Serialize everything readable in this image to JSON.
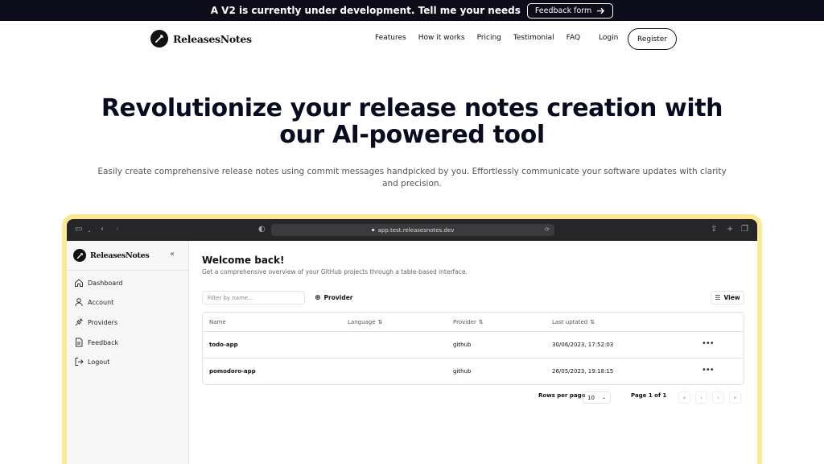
{
  "announcement": {
    "text": "A V2 is currently under development. Tell me your needs",
    "button_label": "Feedback form"
  },
  "brand": {
    "name": "ReleasesNotes"
  },
  "nav": {
    "links": [
      "Features",
      "How it works",
      "Pricing",
      "Testimonial",
      "FAQ"
    ],
    "login": "Login",
    "register": "Register"
  },
  "hero": {
    "title_line1": "Revolutionize your release notes creation with",
    "title_line2": "our AI-powered tool",
    "subtitle": "Easily create comprehensive release notes using commit messages handpicked by you. Effortlessly communicate your software updates with clarity and precision."
  },
  "browser": {
    "url": "app.test.releasesnotes.dev"
  },
  "app": {
    "sidebar": {
      "brand": "ReleasesNotes",
      "items": [
        {
          "label": "Dashboard",
          "icon": "home-icon"
        },
        {
          "label": "Account",
          "icon": "user-icon"
        },
        {
          "label": "Providers",
          "icon": "plug-icon"
        },
        {
          "label": "Feedback",
          "icon": "file-icon"
        },
        {
          "label": "Logout",
          "icon": "logout-icon"
        }
      ]
    },
    "welcome_title": "Welcome back!",
    "welcome_subtitle": "Get a comprehensive overview of your GitHub projects through a table-based interface.",
    "filter_placeholder": "Filter by name...",
    "provider_button": "Provider",
    "view_button": "View",
    "table": {
      "headers": [
        "Name",
        "Language",
        "Provider",
        "Last uptated"
      ],
      "rows": [
        {
          "name": "todo-app",
          "language": "",
          "provider": "github",
          "updated": "30/06/2023, 17:52:03"
        },
        {
          "name": "pomodoro-app",
          "language": "",
          "provider": "github",
          "updated": "26/05/2023, 19:18:15"
        }
      ]
    },
    "pagination": {
      "rows_per_page_label": "Rows per page",
      "rows_per_page_value": "10",
      "page_label": "Page 1 of 1"
    }
  }
}
